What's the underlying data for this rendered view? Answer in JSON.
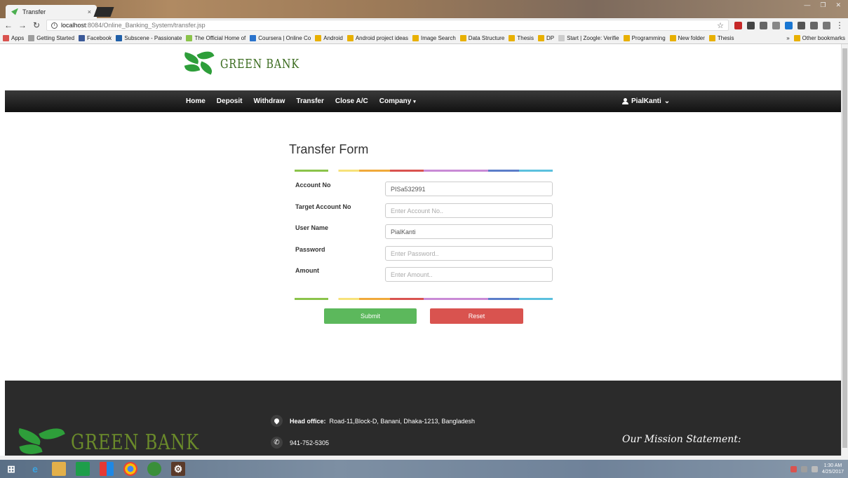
{
  "browser": {
    "tab_title": "Transfer",
    "tab_close": "×",
    "url_host": "localhost",
    "url_path": ":8084/Online_Banking_System/transfer.jsp",
    "window_controls": [
      "—",
      "❐",
      "✕"
    ],
    "bookmarks": [
      {
        "label": "Apps",
        "color": "#d9534f"
      },
      {
        "label": "Getting Started",
        "color": "#9e9e9e"
      },
      {
        "label": "Facebook",
        "color": "#3b5998"
      },
      {
        "label": "Subscene - Passionate",
        "color": "#1f5fa8"
      },
      {
        "label": "The Official Home of",
        "color": "#8bc34a"
      },
      {
        "label": "Coursera | Online Co",
        "color": "#2a73cc"
      },
      {
        "label": "Android",
        "color": "#e8b000"
      },
      {
        "label": "Android project ideas",
        "color": "#e8b000"
      },
      {
        "label": "Image Search",
        "color": "#e8b000"
      },
      {
        "label": "Data Structure",
        "color": "#e8b000"
      },
      {
        "label": "Thesis",
        "color": "#e8b000"
      },
      {
        "label": "DP",
        "color": "#e8b000"
      },
      {
        "label": "Start | Zoogle: Verifie",
        "color": "#cccccc"
      },
      {
        "label": "Programming",
        "color": "#e8b000"
      },
      {
        "label": "New folder",
        "color": "#e8b000"
      },
      {
        "label": "Thesis",
        "color": "#e8b000"
      }
    ],
    "bookmarks_overflow": "»",
    "other_bookmarks": "Other bookmarks"
  },
  "brand": {
    "name": "GREEN BANK"
  },
  "nav": {
    "links": [
      "Home",
      "Deposit",
      "Withdraw",
      "Transfer",
      "Close A/C"
    ],
    "company": "Company",
    "user": "PialKanti"
  },
  "form": {
    "title": "Transfer Form",
    "fields": [
      {
        "label": "Account No",
        "value": "PISa532991",
        "placeholder": ""
      },
      {
        "label": "Target Account No",
        "value": "",
        "placeholder": "Enter Account No.."
      },
      {
        "label": "User Name",
        "value": "PialKanti",
        "placeholder": ""
      },
      {
        "label": "Password",
        "value": "",
        "placeholder": "Enter Password.."
      },
      {
        "label": "Amount",
        "value": "",
        "placeholder": "Enter Amount.."
      }
    ],
    "submit": "Submit",
    "reset": "Reset"
  },
  "footer": {
    "head_office_label": "Head office:",
    "head_office_address": "Road-11,Block-D, Banani, Dhaka-1213, Bangladesh",
    "phone": "941-752-5305",
    "mission_title": "Our Mission Statement:"
  },
  "taskbar": {
    "time": "1:30 AM",
    "date": "4/25/2017"
  },
  "colors": {
    "submit": "#5cb85c",
    "reset": "#d9534f",
    "navbar": "#1a1a1a",
    "brand_green": "#2e9e3a"
  }
}
